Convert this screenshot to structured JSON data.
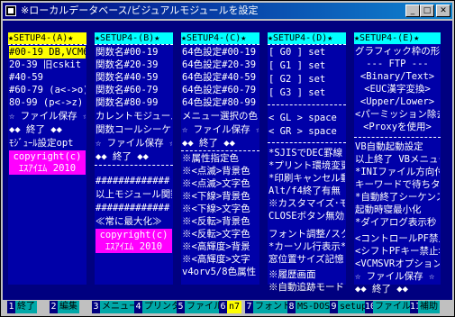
{
  "window": {
    "title": "※ローカルデータベース/ビジュアルモジュールを設定"
  },
  "panels": [
    {
      "header": "SETUP4-(A)",
      "items": [
        "#00-19 DB,VCM6",
        "20-39 旧cskit",
        "#40-59",
        "#60-79 (a<->o)",
        "80-99 (p<->z)",
        "☆ ファイル保存 ☆",
        "◆◆ 終了 ◆◆",
        "ﾓｼﾞｭｰﾙ設定opt",
        "copyright(c)",
        "ｴｽｱｲｴﾑ 2010"
      ]
    },
    {
      "header": "SETUP4-(B)",
      "items": [
        "関数名#00-19",
        "関数名#20-39",
        "関数名#40-59",
        "関数名#60-79",
        "関数名#80-99",
        "カレントモジュール関数",
        "関数コールシーケンス",
        "☆ ファイル保存 ☆",
        "◆◆ 終了 ◆◆",
        "#############",
        "以上モジュール関数",
        "#############",
        "≪常に最大化≫",
        "copyright(c)",
        "ｴｽｱｲｴﾑ 2010"
      ]
    },
    {
      "header": "SETUP4-(C)",
      "items": [
        "64色設定#00-19",
        "64色設定#20-39",
        "64色設定#40-59",
        "64色設定#60-79",
        "64色設定#80-99",
        "メニュー選択の色",
        "☆ ファイル保存 ☆",
        "◆◆ 終了 ◆◆",
        "※属性指定色",
        "※<点滅>背景色",
        "※<点滅>文字色",
        "※<下線>背景色",
        "※<下線>文字色",
        "※<反転>背景色",
        "※<反転>文字色",
        "※<高輝度>背景",
        "※<高輝度>文字",
        "v4orv5/8色属性"
      ]
    },
    {
      "header": "SETUP4-(D)",
      "items": [
        "[ G0 ] set",
        "[ G1 ] set",
        "[ G2 ] set",
        "[ G3 ] set",
        "< GL > space",
        "< GR > space",
        "*SJISでDEC罫線",
        "*プリント環境変更",
        "*印刷キャンセル動作",
        "Alt/f4終了有無",
        "※カスタマイズ･モード",
        "CLOSEボタン無効/",
        "フォント調整/スクロール",
        "*カーソル行表示*",
        "窓位置サイズ記憶",
        "※履歴画面",
        "※自動追跡モード"
      ]
    },
    {
      "header": "SETUP4-(E)",
      "items": [
        "グラフィック枠の形",
        "--- FTP ---",
        "<Binary/Text>",
        "<EUC漢字変換>",
        "<Upper/Lower>",
        "<パーミッション除去>",
        "<Proxyを使用>",
        "VB自動起動設定",
        "以上終了 VBメニュー起動",
        "*INIファイル方向付/",
        "キーワードで待ちタイマー値",
        "*自動終了シーケンス",
        "起動時寝最小化",
        "*ダイアログ表示秒",
        "<コントロールPF禁止>",
        "<シフトPFキー禁止>",
        "<VCMSVRオプション>",
        "☆ ファイル保存 ☆",
        "◆◆ 終了 ◆◆"
      ]
    }
  ],
  "statusbar": {
    "keys": [
      {
        "num": "1",
        "label": "終了"
      },
      {
        "num": "2",
        "label": "編集"
      },
      {
        "num": "3",
        "label": "メニュー"
      },
      {
        "num": "4",
        "label": "プリンター"
      },
      {
        "num": "5",
        "label": "ファイル受"
      },
      {
        "num": "6",
        "label": "n7"
      },
      {
        "num": "7",
        "label": "フォント"
      },
      {
        "num": "8",
        "label": "MS-DOS"
      },
      {
        "num": "9",
        "label": "setup"
      },
      {
        "num": "10",
        "label": "ファイル送"
      },
      {
        "num": "11",
        "label": "補助"
      }
    ]
  }
}
